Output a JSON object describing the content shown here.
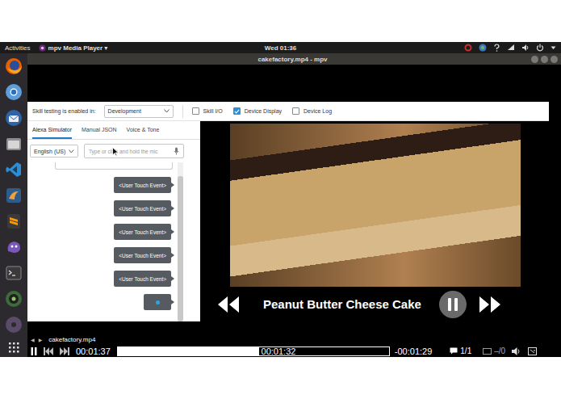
{
  "top_bar": {
    "activities": "Activities",
    "app_menu": "mpv Media Player ▾",
    "clock": "Wed 01:36"
  },
  "window": {
    "title": "cakefactory.mp4 - mpv"
  },
  "video": {
    "simulator": {
      "stage_label": "Skill testing is enabled in:",
      "stage": "Development",
      "toggles": [
        {
          "label": "Skill I/O",
          "checked": false
        },
        {
          "label": "Device Display",
          "checked": true
        },
        {
          "label": "Device Log",
          "checked": false
        }
      ],
      "tabs": [
        {
          "label": "Alexa Simulator",
          "selected": true
        },
        {
          "label": "Manual JSON",
          "selected": false
        },
        {
          "label": "Voice & Tone",
          "selected": false
        }
      ],
      "locale": "English (US)",
      "input_placeholder": "Type or click and hold the mic",
      "messages": [
        {
          "kind": "text",
          "text": "<User Touch Event>"
        },
        {
          "kind": "text",
          "text": "<User Touch Event>"
        },
        {
          "kind": "text",
          "text": "<User Touch Event>"
        },
        {
          "kind": "text",
          "text": "<User Touch Event>"
        },
        {
          "kind": "text",
          "text": "<User Touch Event>"
        },
        {
          "kind": "typing"
        }
      ],
      "device": {
        "title": "Peanut Butter Cheese Cake",
        "playing": true
      }
    }
  },
  "player": {
    "filename": "cakefactory.mp4",
    "prev": "◀",
    "next": "▶",
    "playing": true,
    "elapsed": "00:01:37",
    "hover_time": "00:01:32",
    "level": 0.52,
    "remaining": "-00:01:29",
    "subtitles": "1/1",
    "audio": "–/0"
  }
}
